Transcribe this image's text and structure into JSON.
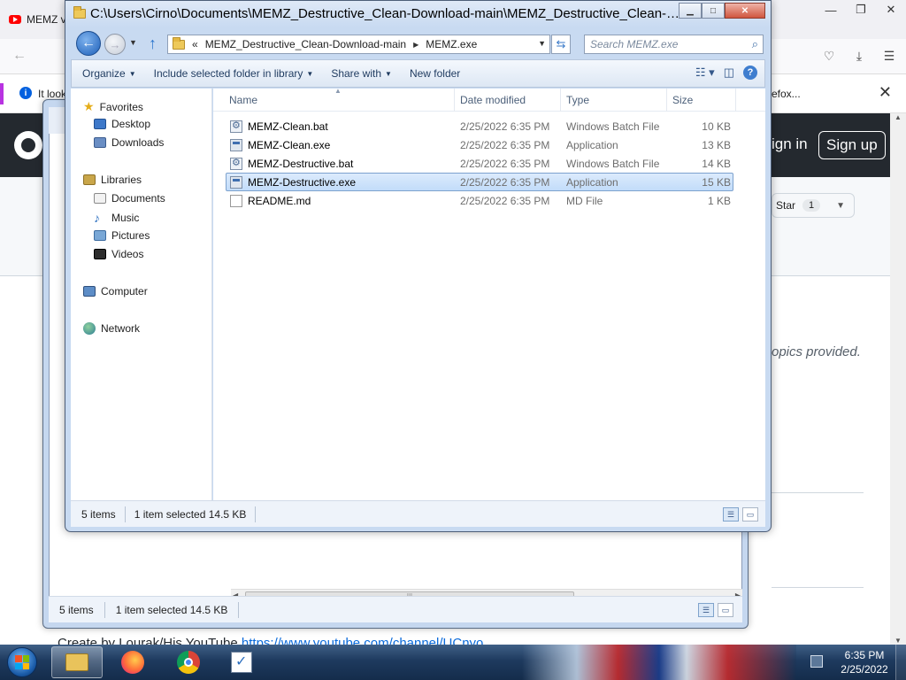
{
  "browser": {
    "tab_title": "MEMZ v",
    "notice_text": "It look",
    "notice_right": "efox...",
    "github": {
      "sign_in": "ign in",
      "sign_up": "Sign up",
      "star_label": "Star",
      "star_count": "1",
      "topics_text": "opics provided.",
      "create_text": "Create by Lourak/His YouTube ",
      "create_link": "https://www.youtube.com/channel/UCnyo"
    }
  },
  "back_window": {
    "status": {
      "items": "5 items",
      "selected": "1 item selected  14.5 KB"
    }
  },
  "explorer": {
    "title": "C:\\Users\\Cirno\\Documents\\MEMZ_Destructive_Clean-Download-main\\MEMZ_Destructive_Clean-Do...",
    "address": {
      "overflow": "«",
      "parent": "MEMZ_Destructive_Clean-Download-main",
      "current": "MEMZ.exe"
    },
    "search_placeholder": "Search MEMZ.exe",
    "commands": {
      "organize": "Organize",
      "include": "Include selected folder in library",
      "share": "Share with",
      "new_folder": "New folder"
    },
    "nav": {
      "favorites": "Favorites",
      "desktop": "Desktop",
      "downloads": "Downloads",
      "libraries": "Libraries",
      "documents": "Documents",
      "music": "Music",
      "pictures": "Pictures",
      "videos": "Videos",
      "computer": "Computer",
      "network": "Network"
    },
    "columns": {
      "name": "Name",
      "date": "Date modified",
      "type": "Type",
      "size": "Size"
    },
    "files": [
      {
        "name": "MEMZ-Clean.bat",
        "date": "2/25/2022 6:35 PM",
        "type": "Windows Batch File",
        "size": "10 KB",
        "icon": "bat-file-icon",
        "selected": false
      },
      {
        "name": "MEMZ-Clean.exe",
        "date": "2/25/2022 6:35 PM",
        "type": "Application",
        "size": "13 KB",
        "icon": "exe-file-icon",
        "selected": false
      },
      {
        "name": "MEMZ-Destructive.bat",
        "date": "2/25/2022 6:35 PM",
        "type": "Windows Batch File",
        "size": "14 KB",
        "icon": "bat-file-icon",
        "selected": false
      },
      {
        "name": "MEMZ-Destructive.exe",
        "date": "2/25/2022 6:35 PM",
        "type": "Application",
        "size": "15 KB",
        "icon": "exe-file-icon",
        "selected": true
      },
      {
        "name": "README.md",
        "date": "2/25/2022 6:35 PM",
        "type": "MD File",
        "size": "1 KB",
        "icon": "text-file-icon",
        "selected": false
      }
    ],
    "status": {
      "items": "5 items",
      "selected": "1 item selected  14.5 KB"
    }
  },
  "taskbar": {
    "time": "6:35 PM",
    "date": "2/25/2022",
    "pinned": [
      "explorer-icon",
      "firefox-icon",
      "chrome-icon",
      "notepad-icon"
    ]
  },
  "colors": {
    "selection": "#c2dcfa",
    "taskbar": "#1e3a5e",
    "github_header": "#24292f"
  }
}
